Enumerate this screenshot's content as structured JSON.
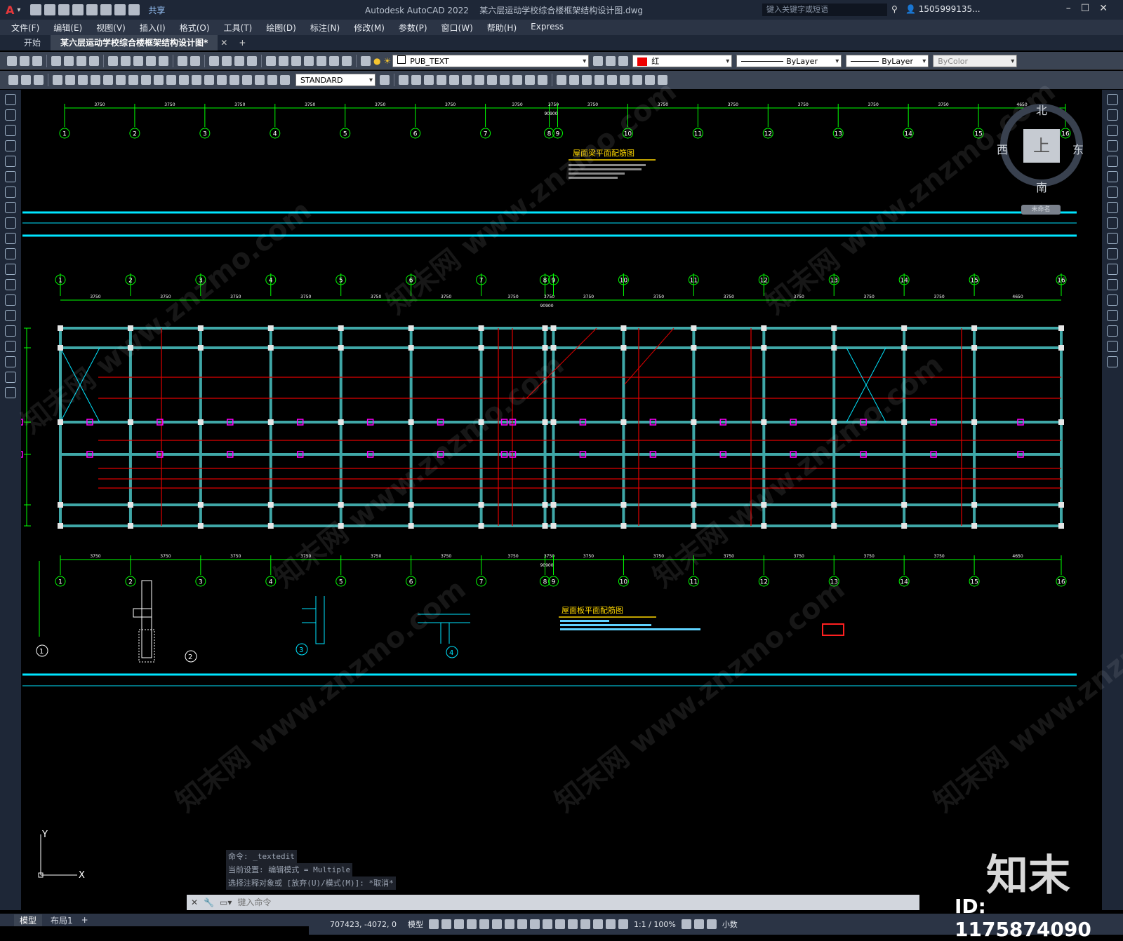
{
  "app": {
    "title": "Autodesk AutoCAD 2022",
    "file": "某六层运动学校综合楼框架结构设计图.dwg",
    "share": "共享"
  },
  "search": {
    "placeholder": "键入关键字或短语"
  },
  "user": {
    "name": "1505999135..."
  },
  "menu": [
    "文件(F)",
    "编辑(E)",
    "视图(V)",
    "插入(I)",
    "格式(O)",
    "工具(T)",
    "绘图(D)",
    "标注(N)",
    "修改(M)",
    "参数(P)",
    "窗口(W)",
    "帮助(H)",
    "Express"
  ],
  "tabs": [
    {
      "label": "开始"
    },
    {
      "label": "某六层运动学校综合楼框架结构设计图*"
    }
  ],
  "toolbar": {
    "layer": "PUB_TEXT",
    "color": "红",
    "linetype": "ByLayer",
    "lineweight": "ByLayer",
    "plotstyle": "ByColor",
    "textstyle": "STANDARD"
  },
  "drawing": {
    "title_beam": "屋面梁平面配筋图",
    "title_slab": "屋面板平面配筋图",
    "axes": [
      "1",
      "2",
      "3",
      "4",
      "5",
      "6",
      "7",
      "8",
      "9",
      "10",
      "11",
      "12",
      "13",
      "14",
      "15",
      "16"
    ],
    "spans": [
      "3750",
      "3750",
      "3750",
      "3750",
      "3750",
      "3750",
      "3750",
      "3750",
      "3750",
      "3750",
      "3750",
      "3750",
      "3750",
      "3750",
      "4650"
    ],
    "total": "90900",
    "section_labels": [
      "1",
      "2",
      "3",
      "4"
    ]
  },
  "viewcube": {
    "n": "北",
    "s": "南",
    "e": "东",
    "w": "西",
    "top": "上",
    "wcs": "未命名"
  },
  "command_history": [
    "命令: _textedit",
    "当前设置: 编辑模式 = Multiple",
    "选择注释对象或 [放弃(U)/模式(M)]: *取消*"
  ],
  "command": {
    "placeholder": "键入命令"
  },
  "layouts": [
    "模型",
    "布局1"
  ],
  "status": {
    "coords": "707423, -4072, 0",
    "space": "模型",
    "scale": "1:1 / 100%",
    "units": "小数"
  },
  "watermark": {
    "logo": "知末",
    "id": "ID: 1175874090",
    "text": "知末网 www.znzmo.com"
  }
}
